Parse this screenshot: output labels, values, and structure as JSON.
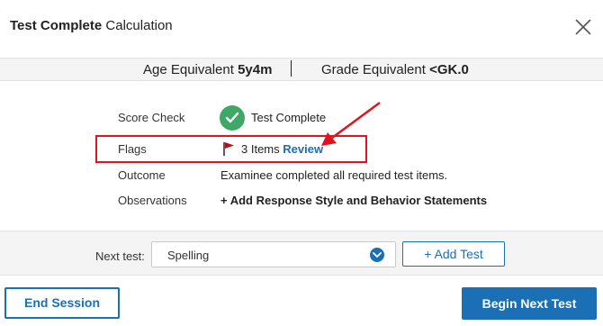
{
  "header": {
    "title_bold": "Test Complete",
    "title_rest": " Calculation"
  },
  "summary": {
    "age_label": "Age Equivalent",
    "age_value": "5y4m",
    "grade_label": "Grade Equivalent",
    "grade_value": "<GK.0"
  },
  "details": {
    "score_check_label": "Score Check",
    "score_check_value": "Test Complete",
    "flags_label": "Flags",
    "flags_count": "3 Items",
    "flags_review": "Review",
    "outcome_label": "Outcome",
    "outcome_value": "Examinee completed all required test items.",
    "observations_label": "Observations",
    "observations_link": "+ Add Response Style and Behavior Statements"
  },
  "next_test": {
    "label": "Next test:",
    "selected": "Spelling",
    "add_button": "+ Add Test"
  },
  "footer": {
    "end_session": "End Session",
    "begin_next": "Begin Next Test"
  },
  "colors": {
    "accent": "#1a6fb5",
    "success": "#3fa866",
    "highlight": "#e0141e",
    "flag": "#b3121a"
  },
  "icons": [
    "close-icon",
    "check-circle-icon",
    "flag-icon",
    "chevron-down-icon",
    "annotation-arrow"
  ]
}
